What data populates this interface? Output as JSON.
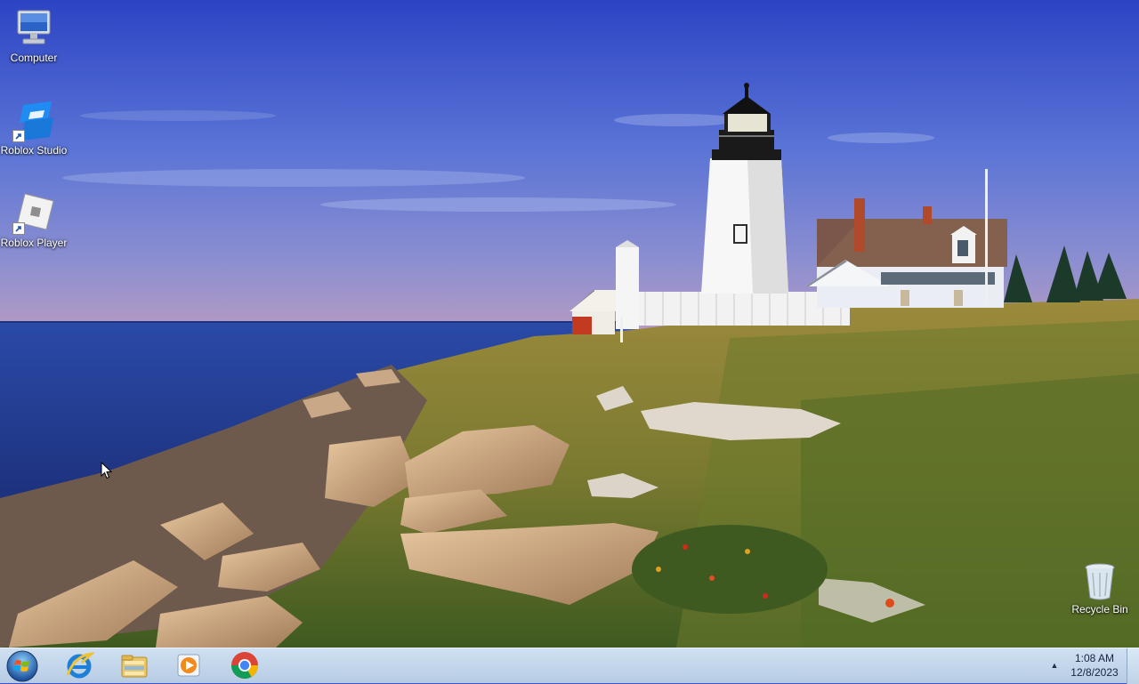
{
  "desktop": {
    "icons": [
      {
        "label": "Computer"
      },
      {
        "label": "Roblox Studio"
      },
      {
        "label": "Roblox Player"
      },
      {
        "label": "Recycle Bin"
      }
    ]
  },
  "taskbar": {
    "start_icon": "windows-orb-icon",
    "apps": [
      "internet-explorer-icon",
      "file-explorer-icon",
      "media-player-icon",
      "chrome-icon"
    ],
    "tray_chevron": "▲",
    "time": "1:08 AM",
    "date": "12/8/2023"
  },
  "colors": {
    "sky_top": "#2f49c8",
    "sea": "#243f9a",
    "taskbar": "#c2d6ec"
  }
}
